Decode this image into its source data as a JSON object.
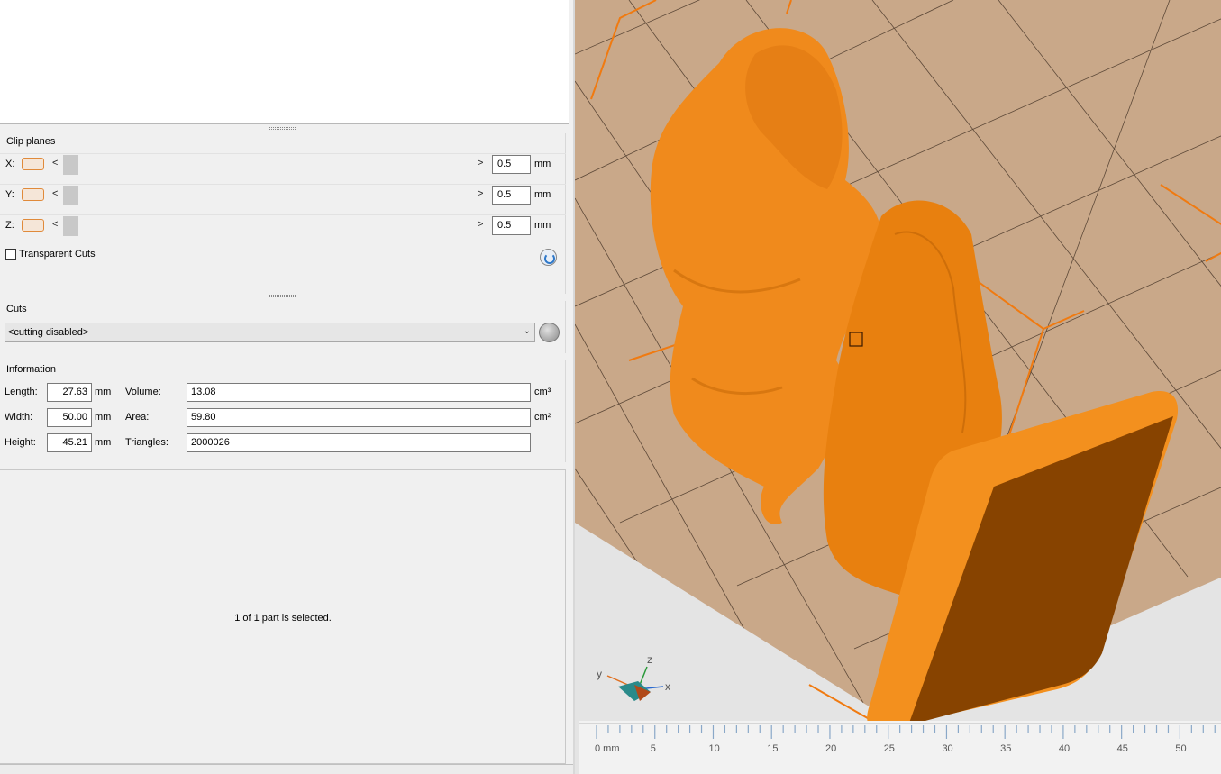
{
  "clip_planes": {
    "title": "Clip planes",
    "axes": [
      {
        "label": "X:",
        "value": "0.5",
        "unit": "mm"
      },
      {
        "label": "Y:",
        "value": "0.5",
        "unit": "mm"
      },
      {
        "label": "Z:",
        "value": "0.5",
        "unit": "mm"
      }
    ],
    "arrow_left": "<",
    "arrow_right": ">",
    "transparent_cuts_label": "Transparent Cuts"
  },
  "cuts": {
    "title": "Cuts",
    "selected": "<cutting disabled>"
  },
  "information": {
    "title": "Information",
    "length_label": "Length:",
    "length_value": "27.63",
    "width_label": "Width:",
    "width_value": "50.00",
    "height_label": "Height:",
    "height_value": "45.21",
    "dim_unit": "mm",
    "volume_label": "Volume:",
    "volume_value": "13.08",
    "volume_unit": "cm³",
    "area_label": "Area:",
    "area_value": "59.80",
    "area_unit": "cm²",
    "triangles_label": "Triangles:",
    "triangles_value": "2000026"
  },
  "selection_status": "1 of 1 part is selected.",
  "viewport": {
    "axis_labels": {
      "x": "x",
      "y": "y",
      "z": "z"
    },
    "ruler_labels": [
      "0 mm",
      "5",
      "10",
      "15",
      "20",
      "25",
      "30",
      "35",
      "40",
      "45",
      "50"
    ],
    "colors": {
      "model": "#f08a1c",
      "bed": "#c9a889",
      "bounding_box": "#f07a10"
    }
  }
}
